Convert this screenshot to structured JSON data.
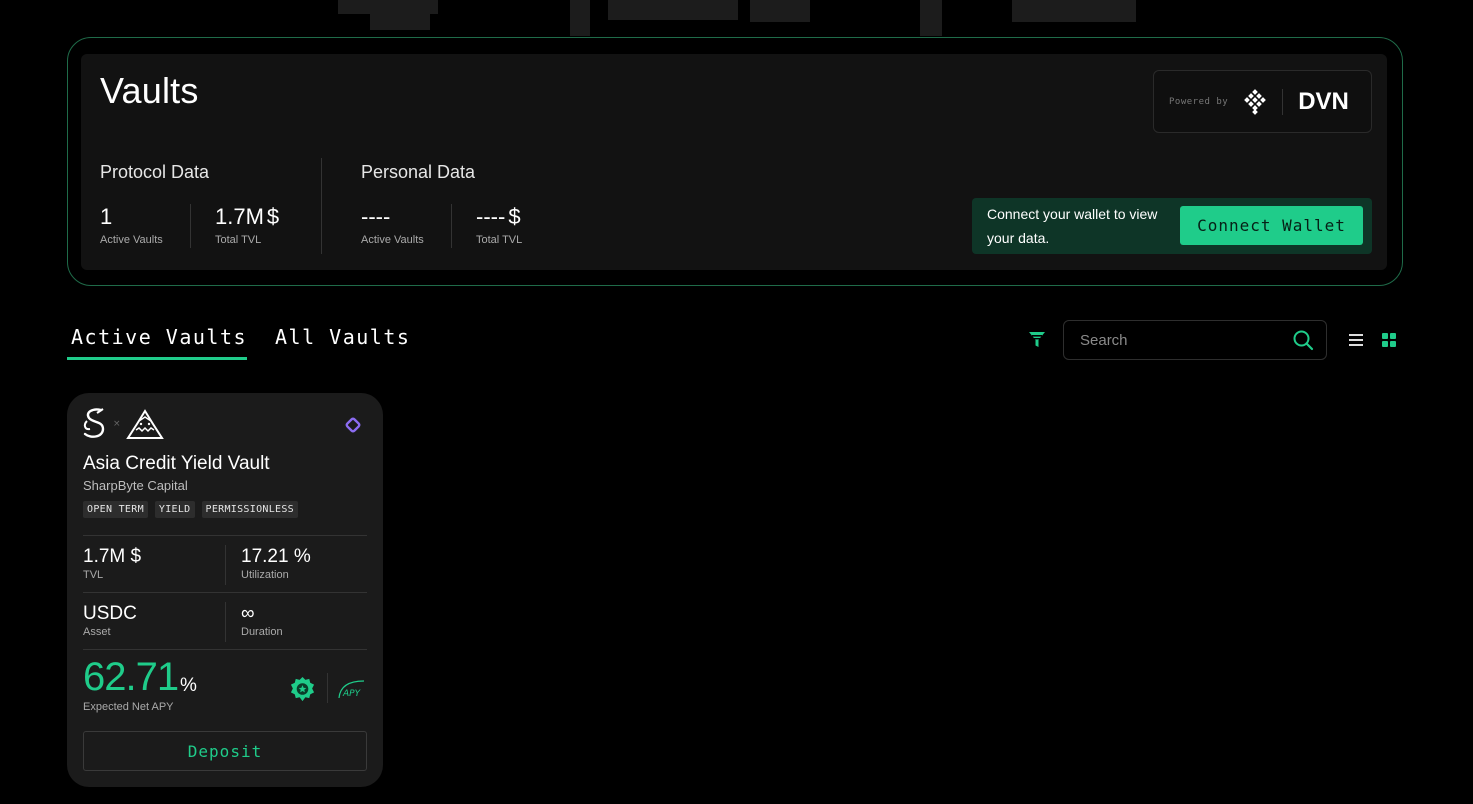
{
  "header": {
    "title": "Vaults",
    "powered_by_label": "Powered by",
    "powered_by_brand": "DVN"
  },
  "protocol_data": {
    "title": "Protocol Data",
    "active_vaults": {
      "value": "1",
      "label": "Active Vaults"
    },
    "total_tvl": {
      "value": "1.7M",
      "unit": "$",
      "label": "Total TVL"
    }
  },
  "personal_data": {
    "title": "Personal Data",
    "active_vaults": {
      "value": "----",
      "label": "Active Vaults"
    },
    "total_tvl": {
      "value": "----",
      "unit": "$",
      "label": "Total TVL"
    }
  },
  "connect": {
    "message": "Connect your wallet to view your data.",
    "button_label": "Connect Wallet"
  },
  "tabs": [
    {
      "label": "Active Vaults",
      "active": true
    },
    {
      "label": "All Vaults",
      "active": false
    }
  ],
  "toolbar": {
    "search_placeholder": "Search",
    "search_value": ""
  },
  "vault": {
    "name": "Asia Credit Yield Vault",
    "manager": "SharpByte Capital",
    "logo_separator": "×",
    "tags": [
      "OPEN TERM",
      "YIELD",
      "PERMISSIONLESS"
    ],
    "tvl": {
      "value": "1.7M $",
      "label": "TVL"
    },
    "utilization": {
      "value": "17.21 %",
      "label": "Utilization"
    },
    "asset": {
      "value": "USDC",
      "label": "Asset"
    },
    "duration": {
      "value": "∞",
      "label": "Duration"
    },
    "apy": {
      "value": "62.71",
      "unit": "%",
      "label": "Expected Net APY"
    },
    "apy_icon_text": "APY",
    "deposit_label": "Deposit"
  },
  "colors": {
    "accent": "#1fcc8a",
    "connect_bg": "#0e3527",
    "card_bg": "#1b1b1b",
    "chain_purple": "#8b6cf0"
  },
  "icons": {
    "filter": "filter-icon",
    "search": "search-icon",
    "list_view": "list-view-icon",
    "grid_view": "grid-view-icon",
    "chain": "chain-diamond-icon",
    "badge": "verified-badge-icon"
  }
}
